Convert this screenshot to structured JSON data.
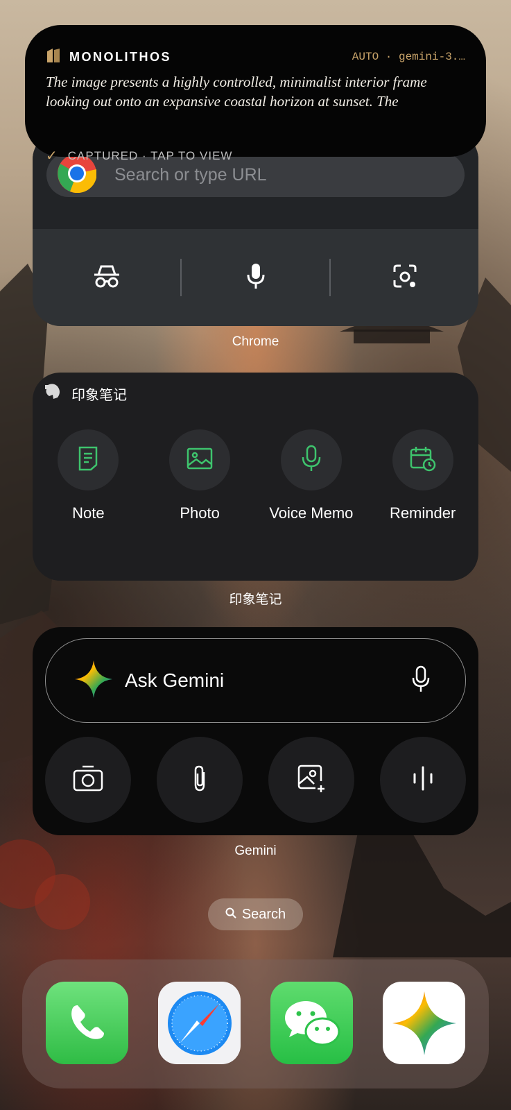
{
  "notification": {
    "app_name": "MONOLITHOS",
    "meta": "AUTO · gemini-3.…",
    "body": "The image presents a highly controlled, minimalist interior frame looking out onto an expansive coastal horizon at sunset. The architectural",
    "status": "CAPTURED · TAP TO VIEW",
    "accent_color": "#c9a46a"
  },
  "chrome_widget": {
    "search_placeholder": "Search or type URL",
    "actions": [
      "incognito-icon",
      "microphone-icon",
      "lens-icon"
    ],
    "label": "Chrome"
  },
  "evernote_widget": {
    "title": "印象笔记",
    "items": [
      {
        "label": "Note",
        "icon": "note-icon"
      },
      {
        "label": "Photo",
        "icon": "photo-icon"
      },
      {
        "label": "Voice Memo",
        "icon": "microphone-icon"
      },
      {
        "label": "Reminder",
        "icon": "reminder-icon"
      }
    ],
    "label": "印象笔记",
    "accent_color": "#3ec46d"
  },
  "gemini_widget": {
    "ask_label": "Ask Gemini",
    "buttons": [
      "camera-icon",
      "attach-icon",
      "add-image-icon",
      "voice-waveform-icon"
    ],
    "label": "Gemini"
  },
  "search_pill": {
    "label": "Search"
  },
  "dock": {
    "apps": [
      "Phone",
      "Safari",
      "WeChat",
      "Gemini"
    ]
  }
}
